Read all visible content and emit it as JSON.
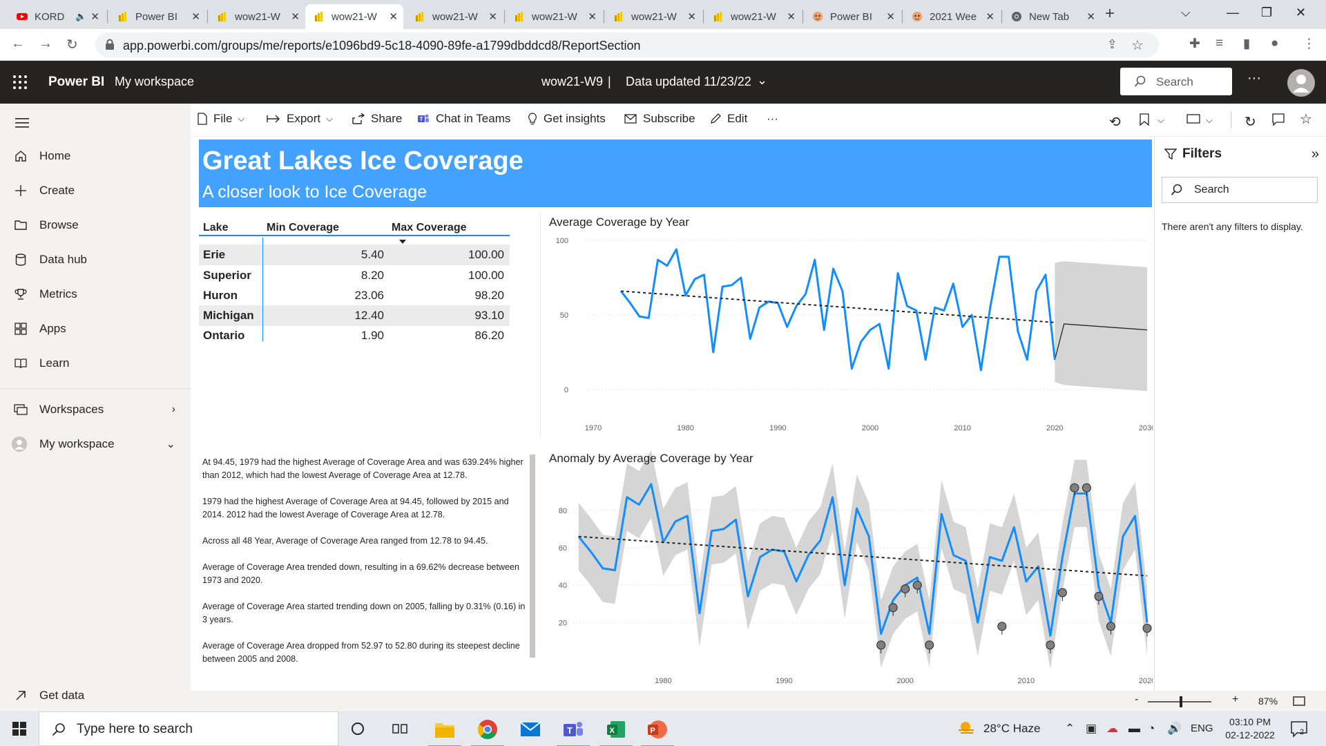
{
  "browser": {
    "tabs": [
      {
        "label": "KORD",
        "icon": "youtube-icon",
        "muted": true
      },
      {
        "label": "Power BI",
        "icon": "powerbi-icon"
      },
      {
        "label": "wow21-W",
        "icon": "powerbi-icon"
      },
      {
        "label": "wow21-W",
        "icon": "powerbi-icon",
        "active": true
      },
      {
        "label": "wow21-W",
        "icon": "powerbi-icon"
      },
      {
        "label": "wow21-W",
        "icon": "powerbi-icon"
      },
      {
        "label": "wow21-W",
        "icon": "powerbi-icon"
      },
      {
        "label": "wow21-W",
        "icon": "powerbi-icon"
      },
      {
        "label": "Power BI",
        "icon": "mascot-icon"
      },
      {
        "label": "2021 Wee",
        "icon": "mascot-icon"
      },
      {
        "label": "New Tab",
        "icon": "chrome-icon"
      }
    ],
    "url": "app.powerbi.com/groups/me/reports/e1096bd9-5c18-4090-89fe-a1799dbddcd8/ReportSection"
  },
  "header": {
    "brand": "Power BI",
    "workspace": "My workspace",
    "report_name": "wow21-W9",
    "separator": "|",
    "data_updated": "Data updated 11/23/22",
    "search_placeholder": "Search",
    "more": "···"
  },
  "nav": {
    "items": [
      {
        "label": "Home",
        "icon": "home-icon"
      },
      {
        "label": "Create",
        "icon": "plus-icon"
      },
      {
        "label": "Browse",
        "icon": "folder-icon"
      },
      {
        "label": "Data hub",
        "icon": "database-icon"
      },
      {
        "label": "Metrics",
        "icon": "trophy-icon"
      },
      {
        "label": "Apps",
        "icon": "apps-icon"
      },
      {
        "label": "Learn",
        "icon": "book-icon"
      }
    ],
    "workspaces": "Workspaces",
    "my_workspace": "My workspace",
    "get_data": "Get data"
  },
  "actions": {
    "file": "File",
    "export": "Export",
    "share": "Share",
    "chat": "Chat in Teams",
    "insights": "Get insights",
    "subscribe": "Subscribe",
    "edit": "Edit",
    "more": "···"
  },
  "report": {
    "title": "Great Lakes Ice Coverage",
    "subtitle": "A closer look to Ice Coverage",
    "table": {
      "headers": [
        "Lake",
        "Min Coverage",
        "Max Coverage"
      ],
      "sorted_column": "Max Coverage",
      "rows": [
        {
          "lake": "Erie",
          "min": "5.40",
          "max": "100.00"
        },
        {
          "lake": "Superior",
          "min": "8.20",
          "max": "100.00"
        },
        {
          "lake": "Huron",
          "min": "23.06",
          "max": "98.20"
        },
        {
          "lake": "Michigan",
          "min": "12.40",
          "max": "93.10"
        },
        {
          "lake": "Ontario",
          "min": "1.90",
          "max": "86.20"
        }
      ]
    },
    "narrative": [
      "At 94.45, 1979 had the highest Average of Coverage Area and was 639.24% higher than 2012, which had the lowest Average of Coverage Area at 12.78.",
      "1979 had the highest Average of Coverage Area at 94.45, followed by 2015 and 2014. 2012 had the lowest Average of Coverage Area at 12.78.",
      "Across all 48 Year, Average of Coverage Area ranged from 12.78 to 94.45.",
      "Average of Coverage Area trended down, resulting in a 69.62% decrease between 1973 and 2020.",
      "Average of Coverage Area started trending down on 2005, falling by 0.31% (0.16) in 3 years.",
      "Average of Coverage Area dropped from 52.97 to 52.80 during its steepest decline between 2005 and 2008."
    ]
  },
  "chart_data": [
    {
      "type": "line",
      "title": "Average Coverage by Year",
      "xlabel": "",
      "ylabel": "",
      "x": [
        1973,
        1974,
        1975,
        1976,
        1977,
        1978,
        1979,
        1980,
        1981,
        1982,
        1983,
        1984,
        1985,
        1986,
        1987,
        1988,
        1989,
        1990,
        1991,
        1992,
        1993,
        1994,
        1995,
        1996,
        1997,
        1998,
        1999,
        2000,
        2001,
        2002,
        2003,
        2004,
        2005,
        2006,
        2007,
        2008,
        2009,
        2010,
        2011,
        2012,
        2013,
        2014,
        2015,
        2016,
        2017,
        2018,
        2019,
        2020
      ],
      "series": [
        {
          "values": [
            66,
            58,
            49,
            48,
            87,
            83,
            94,
            63,
            74,
            77,
            25,
            69,
            70,
            75,
            34,
            55,
            59,
            58,
            42,
            56,
            64,
            87,
            40,
            81,
            66,
            14,
            32,
            40,
            44,
            14,
            78,
            56,
            53,
            20,
            55,
            53,
            71,
            42,
            50,
            13,
            55,
            89,
            89,
            39,
            20,
            66,
            77,
            20
          ]
        }
      ],
      "trendline": {
        "from": [
          1973,
          66
        ],
        "to": [
          2020,
          45
        ]
      },
      "forecast": {
        "x": [
          2020,
          2021,
          2030
        ],
        "values": [
          20,
          44,
          40
        ],
        "band_upper": [
          85,
          86,
          82
        ],
        "band_lower": [
          5,
          3,
          -1
        ]
      },
      "xticks": [
        "1970",
        "1980",
        "1990",
        "2000",
        "2010",
        "2020",
        "2030"
      ],
      "yticks": [
        "0",
        "50",
        "100"
      ],
      "ylim": [
        0,
        100
      ],
      "xlim": [
        1970,
        2030
      ],
      "grid": true,
      "colors": {
        "line": "#118dff",
        "trend": "#252423",
        "band": "#d3d3d3"
      }
    },
    {
      "type": "line",
      "title": "Anomaly by Average Coverage by Year",
      "xlabel": "",
      "ylabel": "",
      "x": [
        1973,
        1974,
        1975,
        1976,
        1977,
        1978,
        1979,
        1980,
        1981,
        1982,
        1983,
        1984,
        1985,
        1986,
        1987,
        1988,
        1989,
        1990,
        1991,
        1992,
        1993,
        1994,
        1995,
        1996,
        1997,
        1998,
        1999,
        2000,
        2001,
        2002,
        2003,
        2004,
        2005,
        2006,
        2007,
        2008,
        2009,
        2010,
        2011,
        2012,
        2013,
        2014,
        2015,
        2016,
        2017,
        2018,
        2019,
        2020
      ],
      "series": [
        {
          "values": [
            66,
            58,
            49,
            48,
            87,
            83,
            94,
            63,
            74,
            77,
            25,
            69,
            70,
            75,
            34,
            55,
            59,
            58,
            42,
            56,
            64,
            87,
            40,
            81,
            66,
            14,
            32,
            40,
            44,
            14,
            78,
            56,
            53,
            20,
            55,
            53,
            71,
            42,
            50,
            13,
            55,
            89,
            89,
            39,
            20,
            66,
            77,
            20
          ]
        }
      ],
      "anomalies": [
        {
          "x": 1998,
          "y": 8
        },
        {
          "x": 1999,
          "y": 28
        },
        {
          "x": 2000,
          "y": 38
        },
        {
          "x": 2001,
          "y": 40
        },
        {
          "x": 2002,
          "y": 8
        },
        {
          "x": 2008,
          "y": 18
        },
        {
          "x": 2012,
          "y": 8
        },
        {
          "x": 2013,
          "y": 36
        },
        {
          "x": 2014,
          "y": 92
        },
        {
          "x": 2015,
          "y": 92
        },
        {
          "x": 2016,
          "y": 34
        },
        {
          "x": 2017,
          "y": 18
        },
        {
          "x": 2020,
          "y": 17
        }
      ],
      "band_width": 18,
      "trendline": {
        "from": [
          1973,
          66
        ],
        "to": [
          2020,
          45
        ]
      },
      "xticks": [
        "1980",
        "1990",
        "2000",
        "2010",
        "2020"
      ],
      "yticks": [
        "20",
        "40",
        "60",
        "80"
      ],
      "ylim": [
        5,
        98
      ],
      "xlim": [
        1972.5,
        2020
      ],
      "grid": true,
      "colors": {
        "line": "#118dff",
        "trend": "#252423",
        "band": "#d3d3d3",
        "marker": "#808080"
      }
    }
  ],
  "filters": {
    "title": "Filters",
    "search_placeholder": "Search",
    "empty": "There aren't any filters to display."
  },
  "zoom": {
    "minus": "-",
    "plus": "+",
    "percent": "87%"
  },
  "taskbar": {
    "search_placeholder": "Type here to search",
    "weather": "28°C  Haze",
    "lang": "ENG",
    "time": "03:10 PM",
    "date": "02-12-2022",
    "notifications": "2"
  }
}
